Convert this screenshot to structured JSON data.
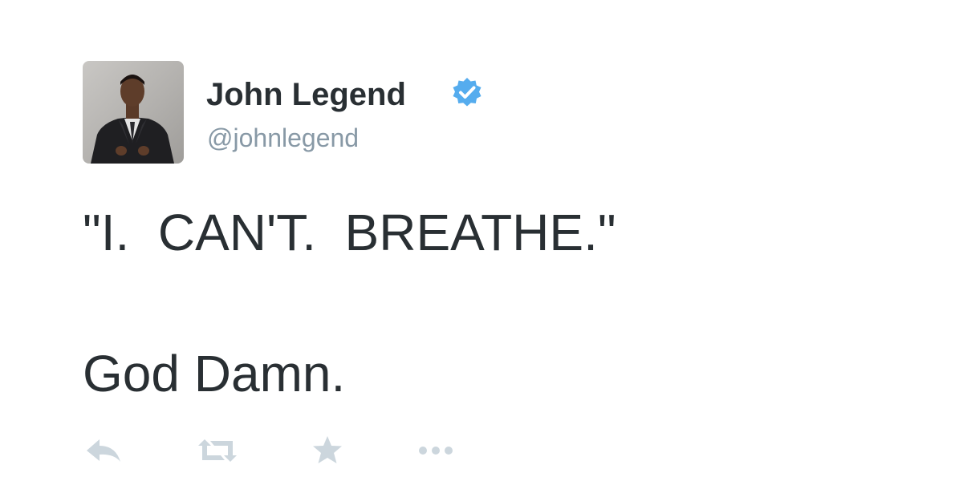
{
  "user": {
    "display_name": "John Legend",
    "handle": "@johnlegend",
    "verified": true,
    "avatar_icon": "profile-photo-man-in-suit"
  },
  "tweet": {
    "lines": [
      "\"I.  CAN'T.  BREATHE.\"",
      "God Damn."
    ]
  },
  "actions": [
    {
      "name": "reply",
      "icon": "reply-icon"
    },
    {
      "name": "retweet",
      "icon": "retweet-icon"
    },
    {
      "name": "favorite",
      "icon": "star-icon"
    },
    {
      "name": "more",
      "icon": "more-dots-icon"
    }
  ],
  "colors": {
    "text": "#292f33",
    "handle": "#8899a6",
    "verified": "#55acee",
    "action_icon": "#ccd6dd"
  }
}
